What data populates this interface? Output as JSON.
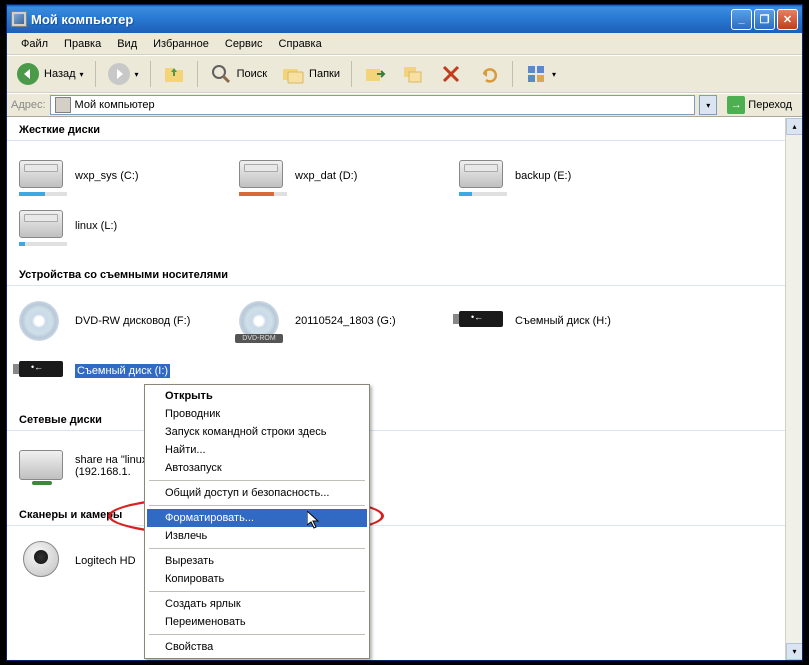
{
  "titlebar": {
    "title": "Мой компьютер"
  },
  "menu": {
    "file": "Файл",
    "edit": "Правка",
    "view": "Вид",
    "favorites": "Избранное",
    "tools": "Сервис",
    "help": "Справка"
  },
  "toolbar": {
    "back": "Назад",
    "search": "Поиск",
    "folders": "Папки"
  },
  "addressbar": {
    "label": "Адрес:",
    "value": "Мой компьютер",
    "go": "Переход"
  },
  "sections": {
    "hdd": "Жесткие диски",
    "removable": "Устройства со съемными носителями",
    "network": "Сетевые диски",
    "scanners": "Сканеры и камеры"
  },
  "drives": {
    "hdd": [
      {
        "label": "wxp_sys (C:)",
        "fill": 55,
        "color": "#3ea8e0"
      },
      {
        "label": "wxp_dat (D:)",
        "fill": 72,
        "color": "#d86a3a"
      },
      {
        "label": "backup (E:)",
        "fill": 28,
        "color": "#3ea8e0"
      },
      {
        "label": "linux (L:)",
        "fill": 12,
        "color": "#3ea8e0"
      }
    ],
    "removable": [
      {
        "label": "DVD-RW дисковод (F:)",
        "type": "dvd"
      },
      {
        "label": "20110524_1803 (G:)",
        "type": "dvdrom",
        "badge": "DVD-ROM"
      },
      {
        "label": "Съемный диск (H:)",
        "type": "usb"
      },
      {
        "label": "Съемный диск (I:)",
        "type": "usb",
        "selected": true
      }
    ],
    "network": [
      {
        "label1": "share на \"linux",
        "label2": "(192.168.1."
      }
    ],
    "scanners": [
      {
        "label": "Logitech HD"
      }
    ]
  },
  "context_menu": {
    "open": "Открыть",
    "explorer": "Проводник",
    "cmd": "Запуск командной строки здесь",
    "find": "Найти...",
    "autorun": "Автозапуск",
    "sharing": "Общий доступ и безопасность...",
    "format": "Форматировать...",
    "eject": "Извлечь",
    "cut": "Вырезать",
    "copy": "Копировать",
    "shortcut": "Создать ярлык",
    "rename": "Переименовать",
    "properties": "Свойства"
  }
}
